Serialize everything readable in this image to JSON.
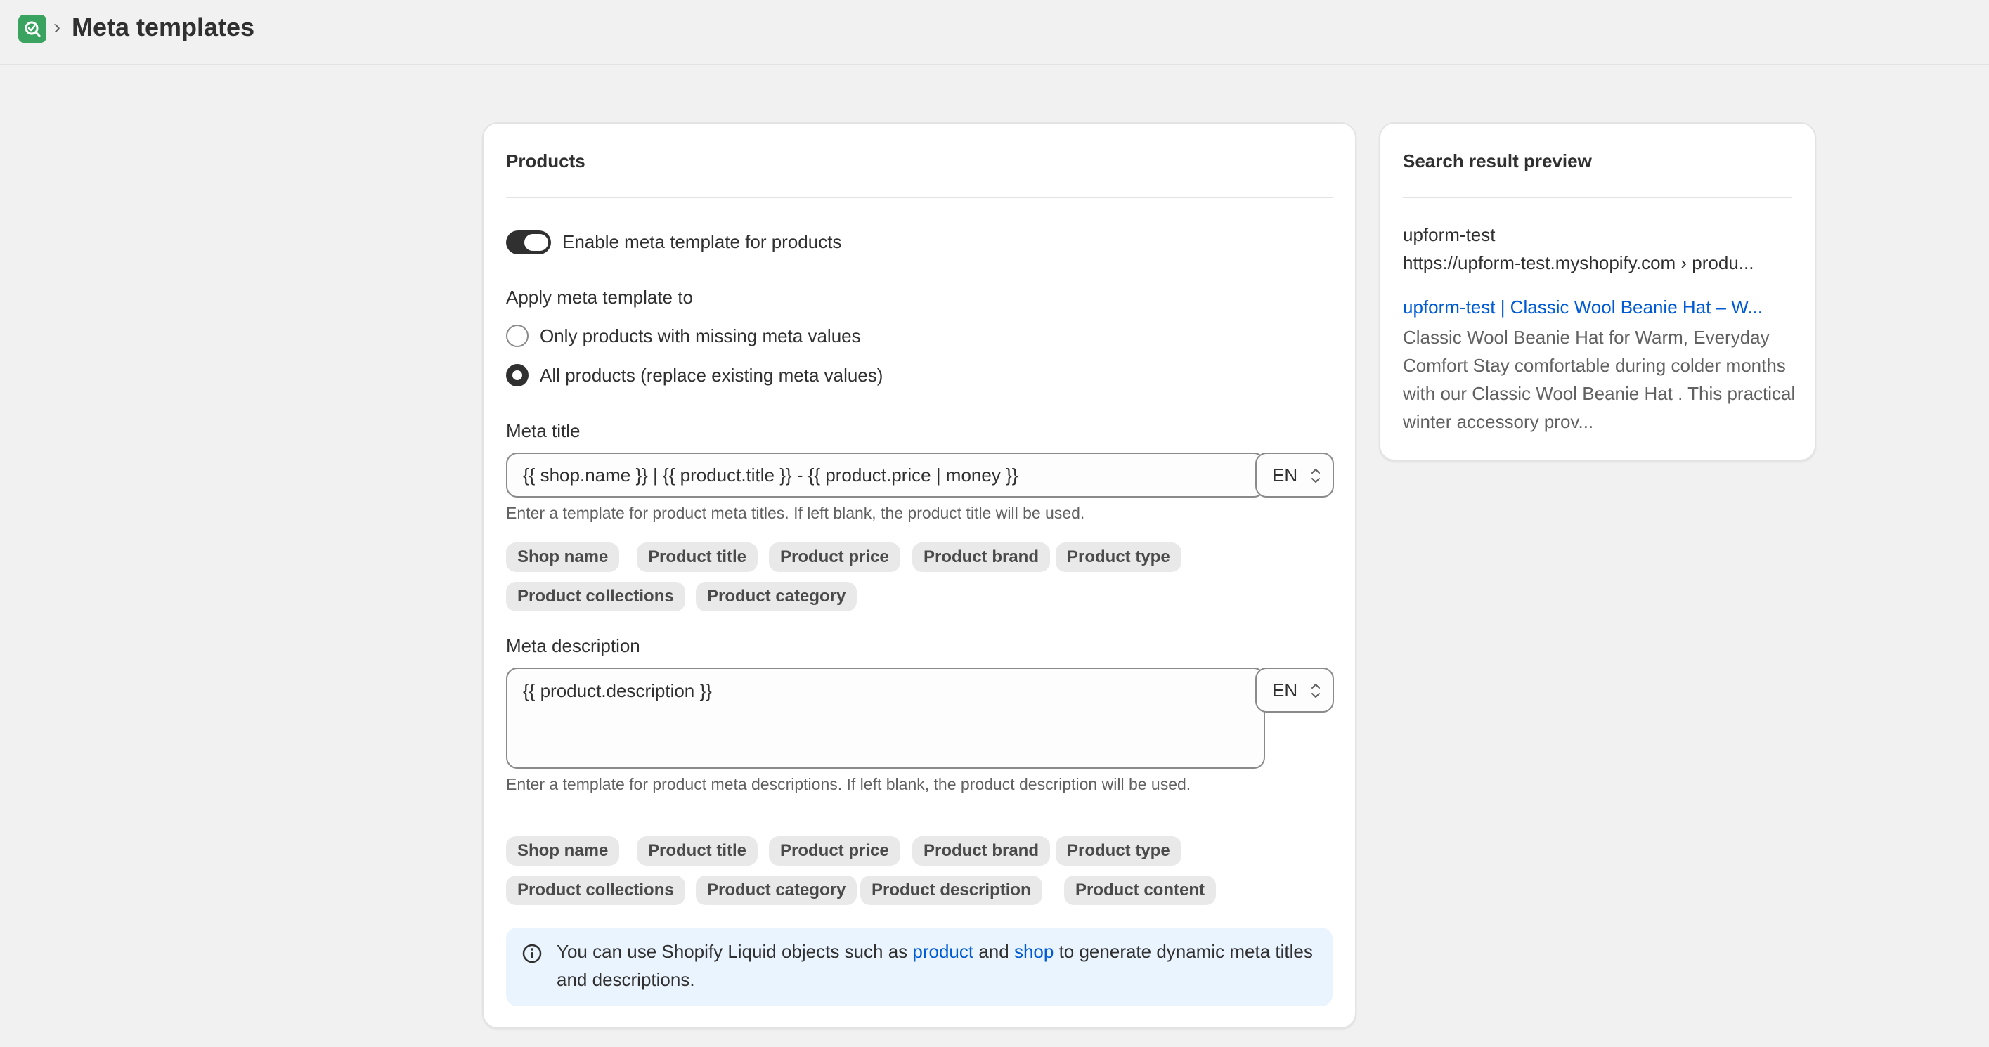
{
  "header": {
    "logo_icon": "magnifier-check-icon",
    "separator": "›",
    "title": "Meta templates"
  },
  "products_card": {
    "title": "Products",
    "toggle": {
      "label": "Enable meta template for products",
      "on": true
    },
    "apply_section": {
      "label": "Apply meta template to",
      "options": [
        {
          "label": "Only products with missing meta values",
          "checked": false
        },
        {
          "label": "All products (replace existing meta values)",
          "checked": true
        }
      ]
    },
    "meta_title": {
      "label": "Meta title",
      "value": "{{ shop.name }} | {{ product.title }} - {{ product.price | money }}",
      "language": "EN",
      "help": "Enter a template for product meta titles. If left blank, the product title will be used.",
      "tags": [
        "Shop name",
        "Product title",
        "Product price",
        "Product brand",
        "Product type",
        "Product collections",
        "Product category"
      ]
    },
    "meta_description": {
      "label": "Meta description",
      "value": "{{ product.description }}",
      "language": "EN",
      "help": "Enter a template for product meta descriptions. If left blank, the product description will be used.",
      "tags": [
        "Shop name",
        "Product title",
        "Product price",
        "Product brand",
        "Product type",
        "Product collections",
        "Product category",
        "Product description",
        "Product content"
      ]
    },
    "info_banner": {
      "icon": "info-icon",
      "text_before": "You can use Shopify Liquid objects such as ",
      "link_product": "product",
      "text_and": " and ",
      "link_shop": "shop",
      "text_after": " to generate dynamic meta titles and descriptions."
    }
  },
  "preview_card": {
    "title": "Search result preview",
    "site_name": "upform-test",
    "url": "https://upform-test.myshopify.com › produ...",
    "result_title": "upform-test | Classic Wool Beanie Hat – W...",
    "result_description": "Classic Wool Beanie Hat for Warm, Everyday Comfort Stay comfortable during colder months with our Classic Wool Beanie Hat . This practical winter accessory prov..."
  },
  "colors": {
    "background": "#f1f1f1",
    "card": "#ffffff",
    "toggle_on": "#303030",
    "link": "#005bd3",
    "banner": "#eaf4ff",
    "logo": "#3aa360"
  }
}
